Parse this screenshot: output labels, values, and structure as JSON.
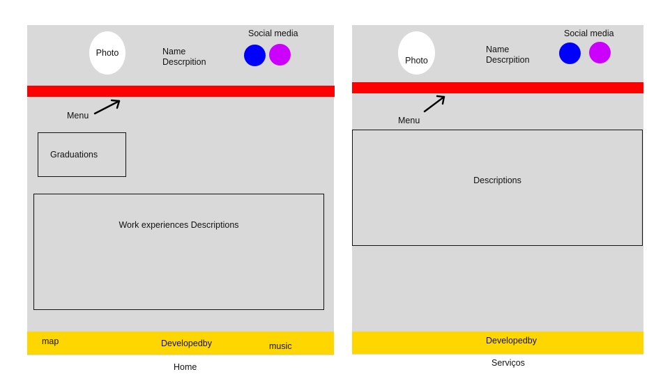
{
  "home": {
    "caption": "Home",
    "header": {
      "photo_label": "Photo",
      "name_label": "Name",
      "description_label": "Descrpition",
      "social_label": "Social media"
    },
    "menu_label": "Menu",
    "graduations_label": "Graduations",
    "work_label": "Work experiences Descriptions",
    "footer": {
      "map_label": "map",
      "developed_label": "Developedby",
      "music_label": "music"
    }
  },
  "servicos": {
    "caption": "Serviços",
    "header": {
      "photo_label": "Photo",
      "name_label": "Name",
      "description_label": "Descrpition",
      "social_label": "Social media"
    },
    "menu_label": "Menu",
    "descriptions_label": "Descriptions",
    "footer": {
      "developed_label": "Developedby"
    }
  },
  "colors": {
    "frame_bg": "#d9d9d9",
    "menu_bar": "#ff0000",
    "footer": "#ffd600",
    "social_blue": "#0000ff",
    "social_purple": "#cc00ff"
  },
  "icons": [
    "arrow-icon",
    "social-circle-icon"
  ]
}
